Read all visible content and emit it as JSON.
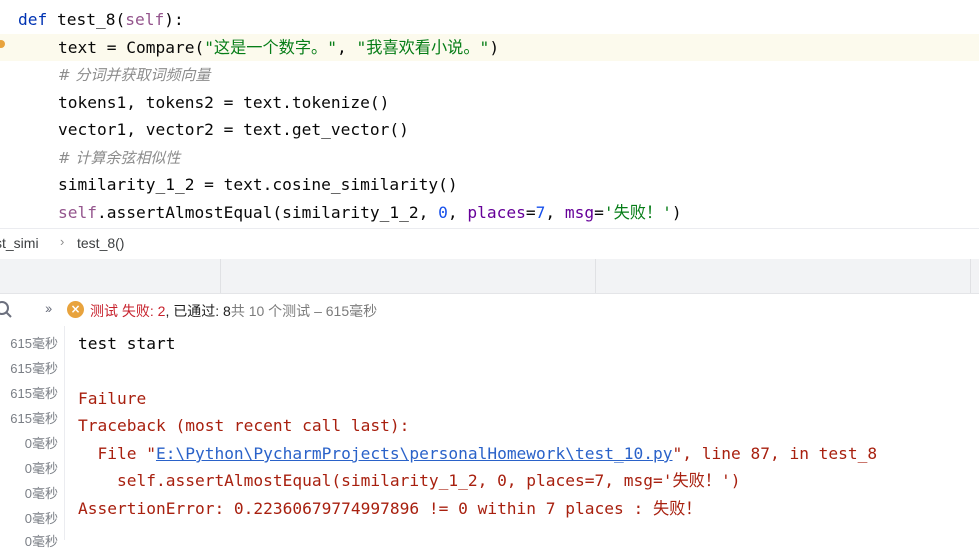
{
  "editor": {
    "def_kw": "def",
    "func_name": "test_8",
    "paren_open": "(",
    "self_kw": "self",
    "paren_close_colon": "):",
    "line2": {
      "pre": "text = Compare(",
      "str1": "\"这是一个数字。\"",
      "comma": ", ",
      "str2": "\"我喜欢看小说。\"",
      "post": ")"
    },
    "comment1": "# 分词并获取词频向量",
    "line4": "tokens1, tokens2 = text.tokenize()",
    "line5": "vector1, vector2 = text.get_vector()",
    "comment2": "# 计算余弦相似性",
    "line7": "similarity_1_2 = text.cosine_similarity()",
    "line8": {
      "self_kw": "self",
      "call": ".assertAlmostEqual(similarity_1_2, ",
      "zero": "0",
      "sep1": ", ",
      "places_kw": "places",
      "eq1": "=",
      "seven": "7",
      "sep2": ", ",
      "msg_kw": "msg",
      "eq2": "=",
      "msg_str": "'失败！'",
      "close": ")"
    }
  },
  "breadcrumb": {
    "class_crumb": "st_simi",
    "separator": "›",
    "method_crumb": "test_8()"
  },
  "runner": {
    "expand_icon": "››",
    "status_prefix": "测试 ",
    "failed_label": "失败: 2",
    "passed_sep": ", 已通过: ",
    "passed_count": "8",
    "total_text": "共 10 个测试 – 615毫秒"
  },
  "console": {
    "timings": [
      "615毫秒",
      "615毫秒",
      "615毫秒",
      "615毫秒",
      "0毫秒",
      "0毫秒",
      "0毫秒",
      "0毫秒",
      "0毫秒"
    ],
    "line1": "test start",
    "line2": "Failure",
    "line3": "Traceback (most recent call last):",
    "file_prefix": "  File \"",
    "file_path": "E:\\Python\\PycharmProjects\\personalHomework\\test_10.py",
    "file_suffix": "\", line 87, in test_8",
    "line5": "    self.assertAlmostEqual(similarity_1_2, 0, places=7, msg='失败！')",
    "line6": "AssertionError: 0.22360679774997896 != 0 within 7 places : 失败！"
  },
  "colors": {
    "keyword": "#0033b3",
    "self": "#94558d",
    "string": "#067d17",
    "number": "#1750eb",
    "kwarg": "#660099",
    "error_text": "#a8200f",
    "fail_status": "#c7222d",
    "warning_icon": "#e8a33d",
    "link": "#2a62c9"
  },
  "icons": {
    "run_status": "warning-circle-icon",
    "toolbar": "search-icon",
    "expand": "double-chevron-right-icon"
  }
}
